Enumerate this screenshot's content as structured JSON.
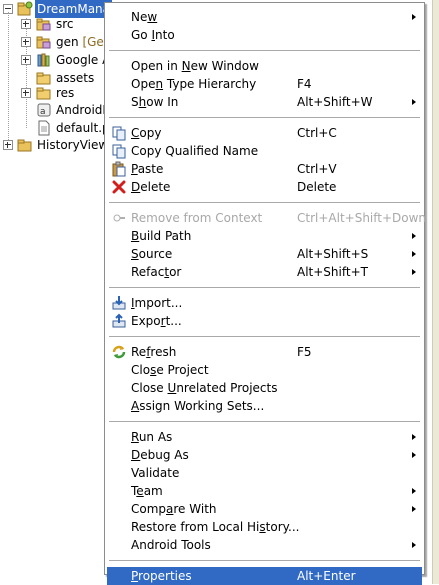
{
  "tree": {
    "project_label": "DreamMana",
    "items": [
      {
        "label": "src",
        "icon": "source-folder-icon"
      },
      {
        "label": "gen",
        "decoration": "[Ge",
        "icon": "source-folder-icon"
      },
      {
        "label": "Google A",
        "icon": "library-icon"
      },
      {
        "label": "assets",
        "icon": "folder-icon"
      },
      {
        "label": "res",
        "icon": "folder-icon"
      },
      {
        "label": "AndroidM",
        "icon": "android-manifest-icon"
      },
      {
        "label": "default.p",
        "icon": "file-icon"
      }
    ],
    "second_project_label": "HistoryView"
  },
  "menu": {
    "items": [
      {
        "label": "New",
        "mn": 2,
        "submenu": true
      },
      {
        "label": "Go Into",
        "mn": 3
      },
      {
        "sep": true
      },
      {
        "label": "Open in New Window",
        "mn": 8
      },
      {
        "label": "Open Type Hierarchy",
        "mn": 3,
        "shortcut": "F4"
      },
      {
        "label": "Show In",
        "mn": 1,
        "shortcut": "Alt+Shift+W",
        "submenu": true
      },
      {
        "sep": true
      },
      {
        "label": "Copy",
        "mn": 0,
        "shortcut": "Ctrl+C",
        "icon": "copy-icon"
      },
      {
        "label": "Copy Qualified Name",
        "icon": "copy-qualified-name-icon"
      },
      {
        "label": "Paste",
        "mn": 0,
        "shortcut": "Ctrl+V",
        "icon": "paste-icon"
      },
      {
        "label": "Delete",
        "mn": 0,
        "shortcut": "Delete",
        "icon": "delete-icon"
      },
      {
        "sep": true
      },
      {
        "label": "Remove from Context",
        "shortcut": "Ctrl+Alt+Shift+Down",
        "disabled": true,
        "icon": "remove-context-icon"
      },
      {
        "label": "Build Path",
        "mn": 0,
        "submenu": true
      },
      {
        "label": "Source",
        "mn": 0,
        "shortcut": "Alt+Shift+S",
        "submenu": true
      },
      {
        "label": "Refactor",
        "mn": 5,
        "shortcut": "Alt+Shift+T",
        "submenu": true
      },
      {
        "sep": true
      },
      {
        "label": "Import...",
        "mn": 0,
        "icon": "import-icon"
      },
      {
        "label": "Export...",
        "mn": 4,
        "icon": "export-icon"
      },
      {
        "sep": true
      },
      {
        "label": "Refresh",
        "mn": 2,
        "shortcut": "F5",
        "icon": "refresh-icon"
      },
      {
        "label": "Close Project",
        "mn": 3
      },
      {
        "label": "Close Unrelated Projects",
        "mn": 6
      },
      {
        "label": "Assign Working Sets...",
        "mn": 0
      },
      {
        "sep": true
      },
      {
        "label": "Run As",
        "mn": 0,
        "submenu": true
      },
      {
        "label": "Debug As",
        "mn": 0,
        "submenu": true
      },
      {
        "label": "Validate"
      },
      {
        "label": "Team",
        "mn": 1,
        "submenu": true
      },
      {
        "label": "Compare With",
        "mn": 4,
        "submenu": true
      },
      {
        "label": "Restore from Local History...",
        "mn": 21
      },
      {
        "label": "Android Tools",
        "submenu": true
      },
      {
        "sep": true
      },
      {
        "label": "Properties",
        "mn": 0,
        "shortcut": "Alt+Enter",
        "highlighted": true
      }
    ]
  },
  "colors": {
    "selection": "#316ac5",
    "menu_border": "#8c8c8c",
    "disabled_text": "#a8a8a8"
  }
}
